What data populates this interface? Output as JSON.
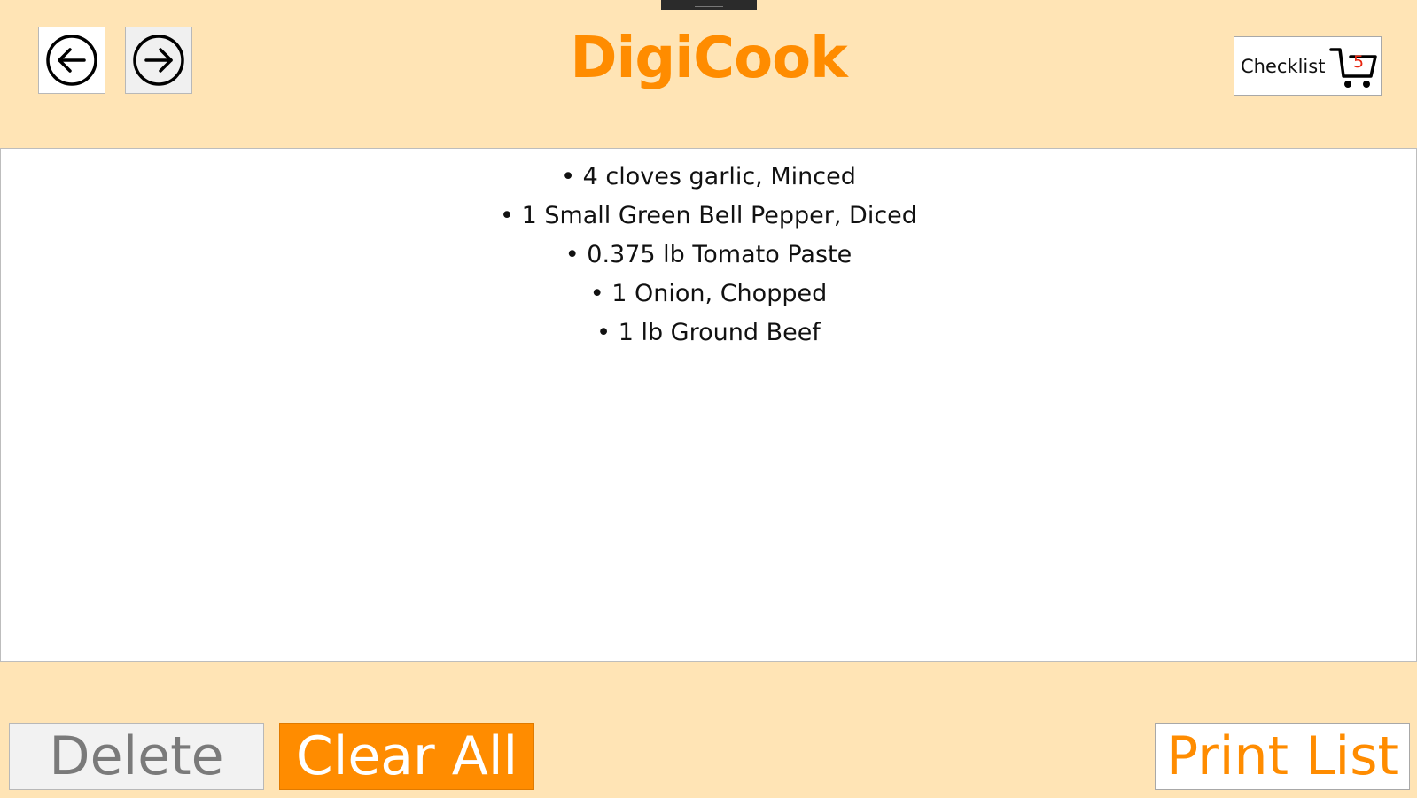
{
  "app": {
    "title": "DigiCook",
    "accent_color": "#FF8C00",
    "background_color": "#FFE4B5"
  },
  "header": {
    "back_icon": "circle-arrow-left-icon",
    "forward_icon": "circle-arrow-right-icon",
    "checklist": {
      "label": "Checklist",
      "count": "5",
      "icon": "shopping-cart-icon",
      "count_color": "#E8250F"
    }
  },
  "checklist_items": [
    "4 cloves garlic, Minced",
    "1 Small Green Bell Pepper, Diced",
    "0.375 lb Tomato Paste",
    "1 Onion, Chopped",
    "1 lb Ground Beef"
  ],
  "footer": {
    "delete_label": "Delete",
    "clear_all_label": "Clear All",
    "print_label": "Print List"
  }
}
